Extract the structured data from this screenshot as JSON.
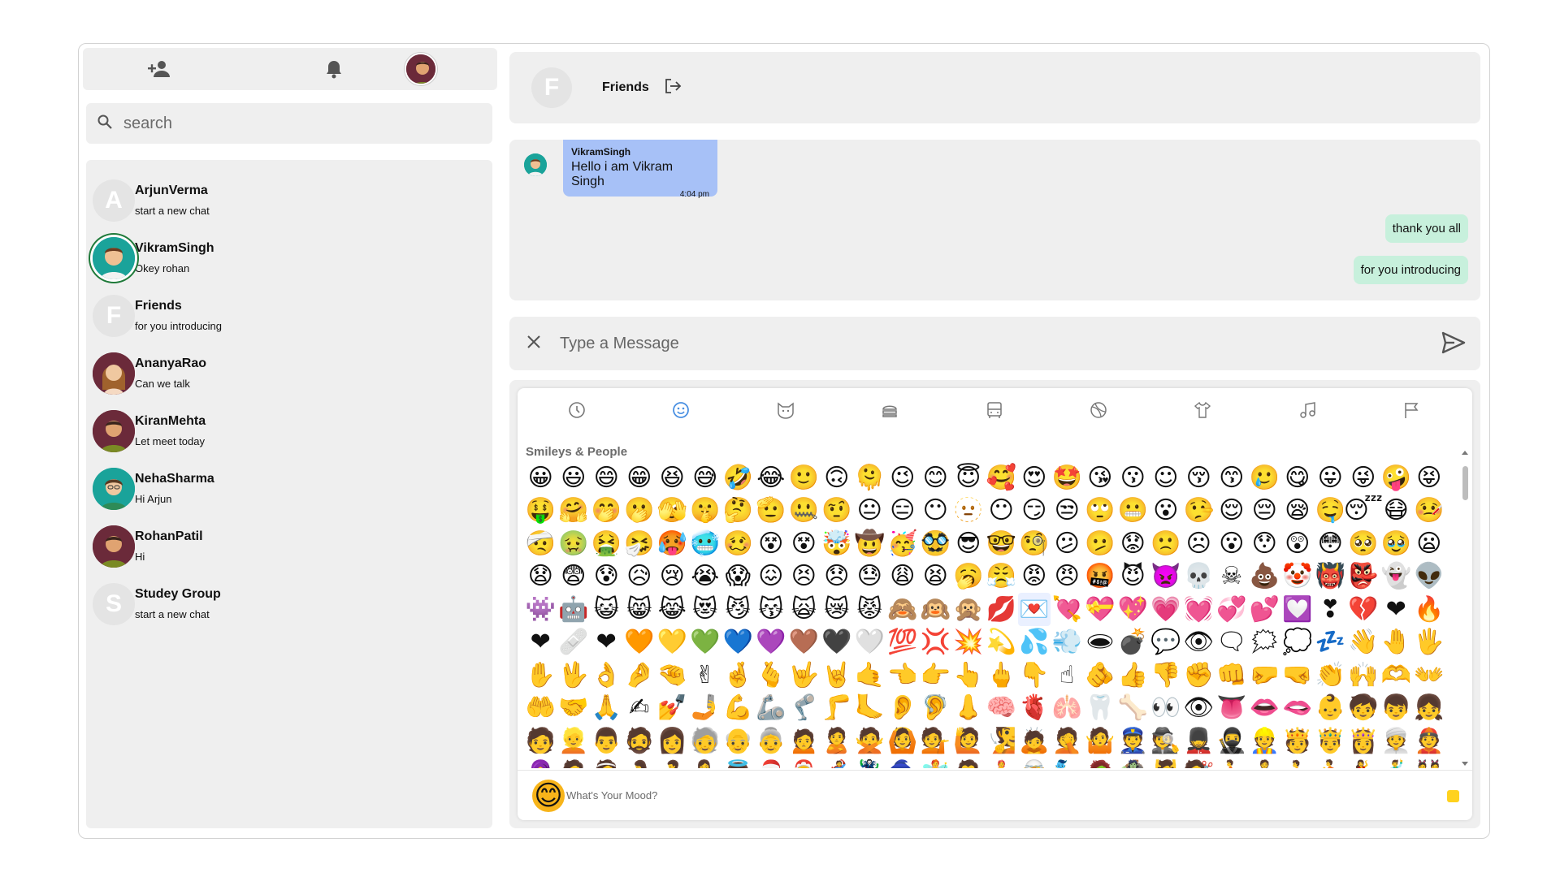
{
  "search": {
    "placeholder": "search"
  },
  "contacts": [
    {
      "name": "ArjunVerma",
      "message": "start a new chat",
      "initial": "A"
    },
    {
      "name": "VikramSingh",
      "message": "Okey rohan",
      "initial": ""
    },
    {
      "name": "Friends",
      "message": "for you introducing",
      "initial": "F"
    },
    {
      "name": "AnanyaRao",
      "message": "Can we talk",
      "initial": ""
    },
    {
      "name": "KiranMehta",
      "message": "Let meet today",
      "initial": ""
    },
    {
      "name": "NehaSharma",
      "message": "Hi Arjun",
      "initial": ""
    },
    {
      "name": "RohanPatil",
      "message": "Hi",
      "initial": ""
    },
    {
      "name": "Studey Group",
      "message": "start a new chat",
      "initial": "S"
    }
  ],
  "chat": {
    "initial": "F",
    "name": "Friends",
    "incoming": {
      "sender": "VikramSingh",
      "text": "Hello i am Vikram Singh",
      "time": "4:04 pm"
    },
    "outgoing": [
      "thank you all",
      "for you introducing"
    ]
  },
  "composer": {
    "placeholder": "Type a Message"
  },
  "emoji_picker": {
    "section": "Smileys & People",
    "mood_placeholder": "What's Your Mood?",
    "mood_emoji": "😊",
    "categories": [
      "recent-icon",
      "smileys-icon",
      "animals-icon",
      "food-icon",
      "travel-icon",
      "activities-icon",
      "objects-icon",
      "symbols-icon",
      "flags-icon"
    ],
    "skin_color": "#ffd21e"
  },
  "colors": {
    "incoming_bubble": "#a7c1f7",
    "outgoing_bubble": "#c7f0dc",
    "active_ring": "#1f7a3a",
    "panel": "#efefef"
  }
}
